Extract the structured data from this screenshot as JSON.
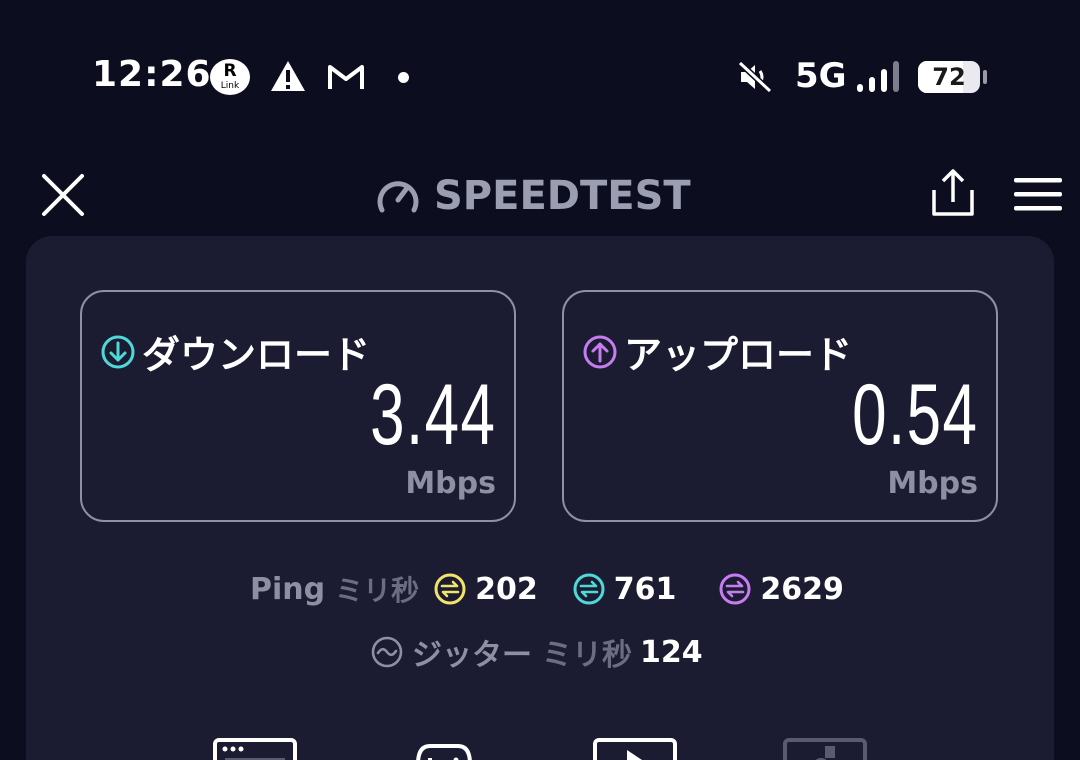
{
  "status_bar": {
    "time": "12:26",
    "rlink_top": "R",
    "rlink_bottom": "Link",
    "icons": [
      "rlink-icon",
      "warning-icon",
      "gmail-icon",
      "notification-dot-icon",
      "mute-icon",
      "signal-icon",
      "battery-icon"
    ],
    "network": "5G",
    "battery_level": "72",
    "battery_fraction": 0.72
  },
  "header": {
    "title": "SPEEDTEST",
    "icons": [
      "close-icon",
      "speedometer-icon",
      "share-icon",
      "menu-icon"
    ]
  },
  "download": {
    "label": "ダウンロード",
    "value": "3.44",
    "unit": "Mbps",
    "color": "#4fd8d8"
  },
  "upload": {
    "label": "アップロード",
    "value": "0.54",
    "unit": "Mbps",
    "color": "#c87cf2"
  },
  "ping": {
    "label": "Ping",
    "unit": "ミリ秒",
    "items": [
      {
        "value": "202",
        "color": "#f2e36a"
      },
      {
        "value": "761",
        "color": "#4fd8d8"
      },
      {
        "value": "2629",
        "color": "#c87cf2"
      }
    ]
  },
  "jitter": {
    "label": "ジッター",
    "unit": "ミリ秒",
    "value": "124"
  },
  "colors": {
    "background": "#0c0d1e",
    "panel": "#1b1c31",
    "muted_text": "#8e8fa2"
  }
}
